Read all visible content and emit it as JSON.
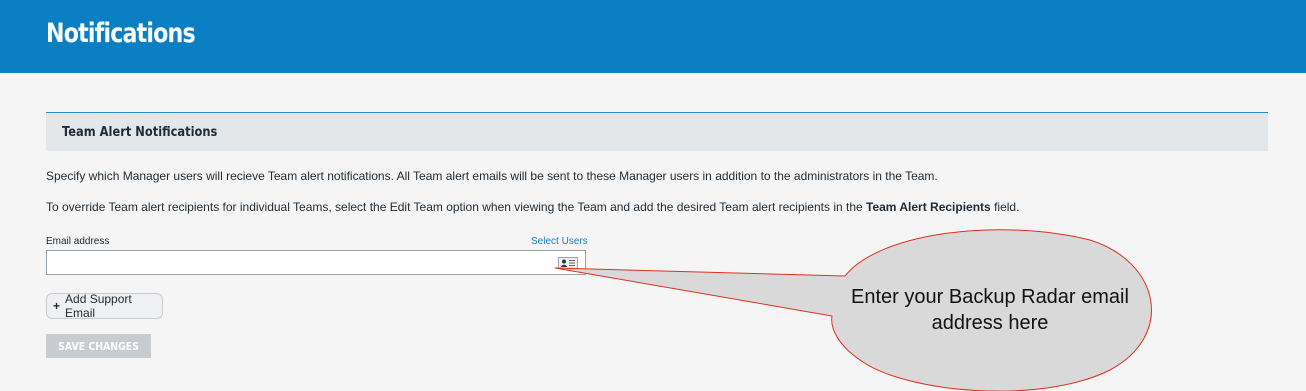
{
  "header": {
    "title": "Notifications",
    "color": "#0a7fc4"
  },
  "section": {
    "title": "Team Alert Notifications",
    "description_1": "Specify which Manager users will recieve Team alert notifications. All Team alert emails will be sent to these Manager users in addition to the administrators in the Team.",
    "description_2_prefix": "To override Team alert recipients for individual Teams, select the Edit Team option when viewing the Team and add the desired Team alert recipients in the ",
    "description_2_bold": "Team Alert Recipients",
    "description_2_suffix": " field."
  },
  "form": {
    "email_label": "Email address",
    "select_users_link": "Select Users",
    "email_value": "",
    "contact_icon": "contact-card-icon",
    "add_support_email_label": "Add Support Email",
    "add_icon": "plus-icon",
    "save_label": "SAVE CHANGES"
  },
  "annotation": {
    "text": "Enter your Backup Radar email address here",
    "line_color": "#e0301e",
    "bubble_color": "#d9d9d9"
  }
}
